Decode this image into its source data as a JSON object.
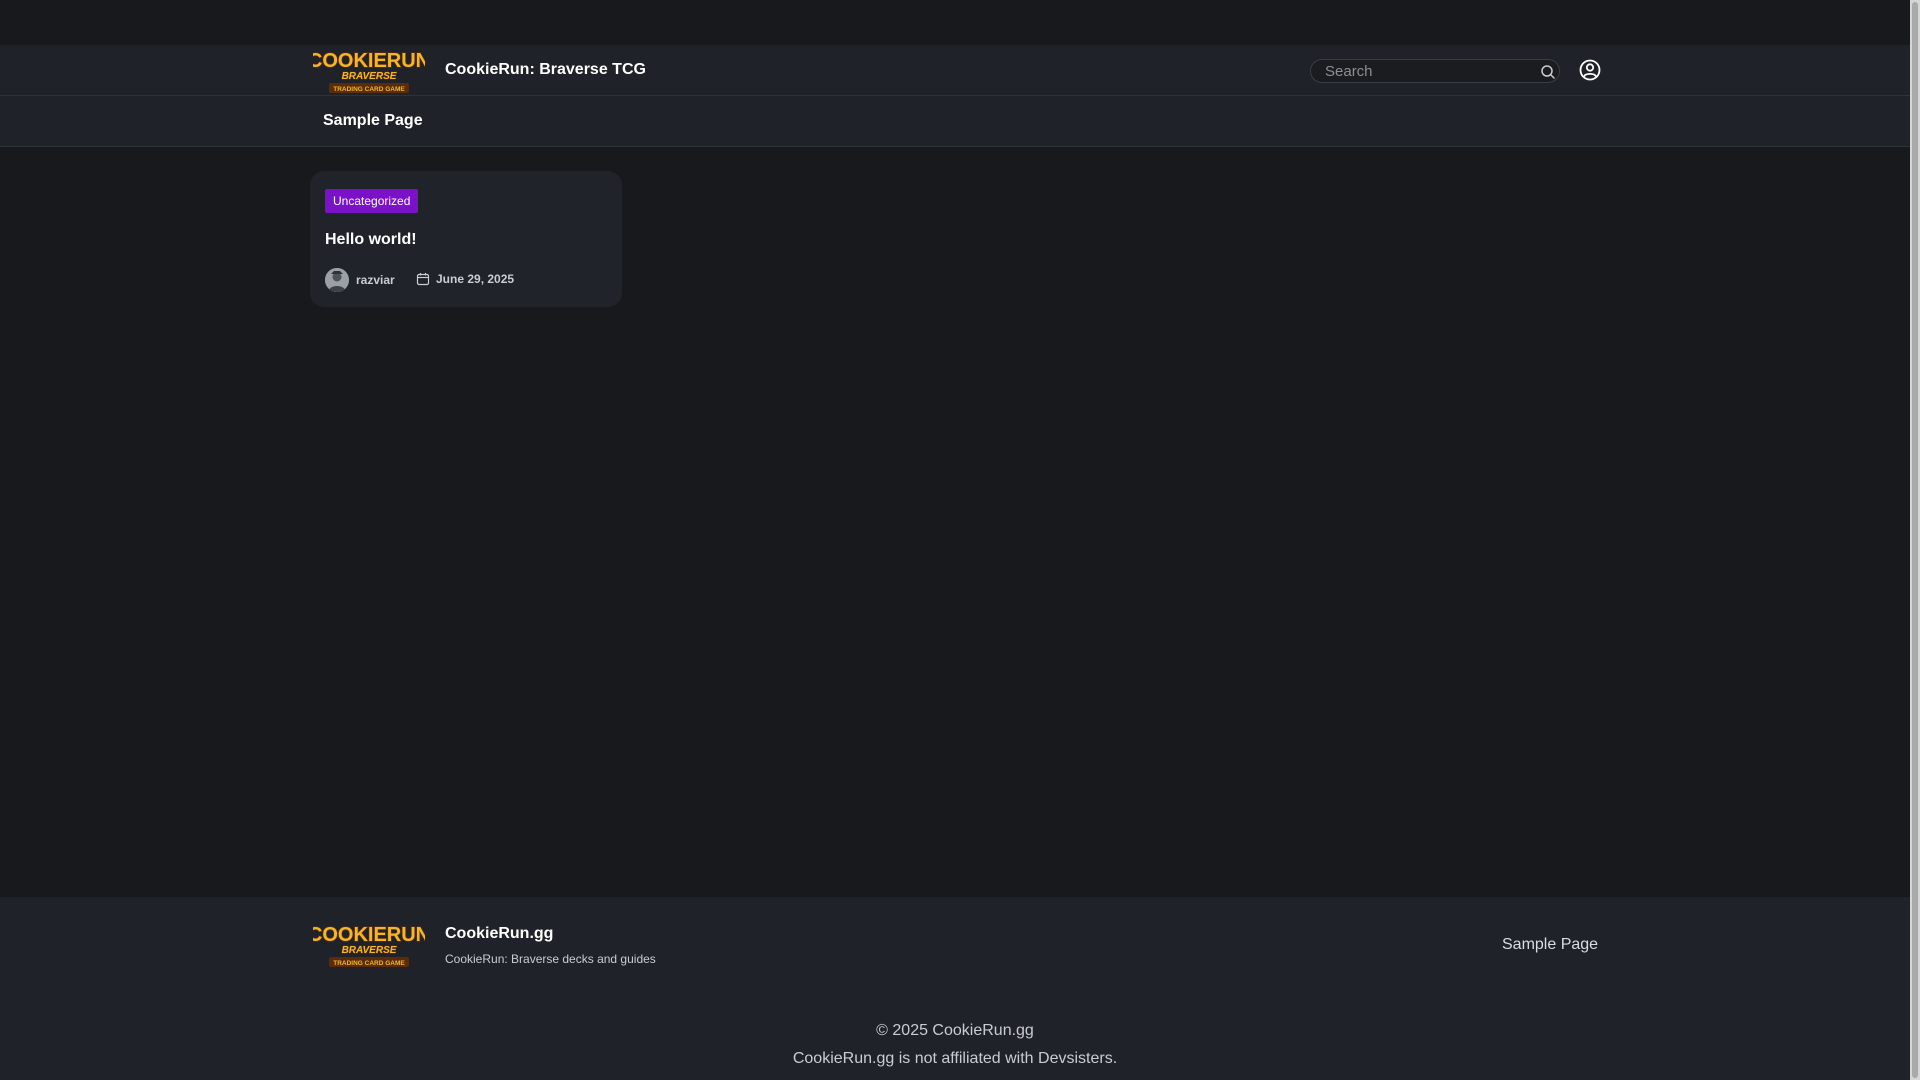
{
  "header": {
    "site_title": "CookieRun: Braverse TCG",
    "logo": {
      "word1": "COOKIERUN",
      "word2": "BRAVERSE",
      "word3": "TRADING CARD GAME"
    },
    "search_placeholder": "Search",
    "search_icon": "search-icon",
    "account_icon": "account-icon"
  },
  "nav": {
    "items": [
      {
        "label": "Sample Page"
      }
    ]
  },
  "posts": [
    {
      "category": "Uncategorized",
      "title": "Hello world!",
      "author": "razviar",
      "date": "June 29, 2025"
    }
  ],
  "footer": {
    "site_title": "CookieRun.gg",
    "tagline": "CookieRun: Braverse decks and guides",
    "menu": [
      {
        "label": "Sample Page"
      }
    ],
    "copyright": "© 2025 CookieRun.gg",
    "disclaimer": "CookieRun.gg is not affiliated with Devsisters."
  },
  "colors": {
    "page_bg": "#17191d",
    "bar_bg": "#1f2228",
    "card_bg": "#20232a",
    "category_badge": "#7a12c8",
    "logo_gold": "#f2b629",
    "logo_outline": "#5a2c0c"
  }
}
